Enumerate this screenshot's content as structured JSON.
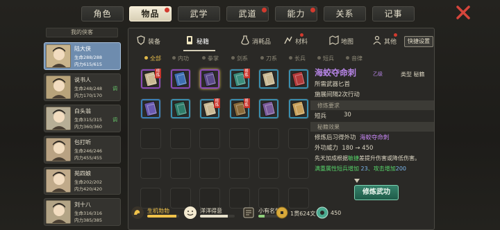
{
  "top_tabs": [
    {
      "label": "角色",
      "active": false,
      "badge": false
    },
    {
      "label": "物品",
      "active": true,
      "badge": true
    },
    {
      "label": "武学",
      "active": false,
      "badge": false
    },
    {
      "label": "武道",
      "active": false,
      "badge": true
    },
    {
      "label": "能力",
      "active": false,
      "badge": true
    },
    {
      "label": "关系",
      "active": false,
      "badge": false
    },
    {
      "label": "记事",
      "active": false,
      "badge": false
    }
  ],
  "sidebar": {
    "title": "我的侠客",
    "characters": [
      {
        "name": "陆大侠",
        "hp": "生命288/288",
        "mp": "内力615/615",
        "selected": true,
        "tag": ""
      },
      {
        "name": "说书人",
        "hp": "生命248/248",
        "mp": "内力170/170",
        "selected": false,
        "tag": "调"
      },
      {
        "name": "白头翁",
        "hp": "生命315/315",
        "mp": "内力360/360",
        "selected": false,
        "tag": "调"
      },
      {
        "name": "包打听",
        "hp": "生命246/246",
        "mp": "内力455/455",
        "selected": false,
        "tag": ""
      },
      {
        "name": "苑四娘",
        "hp": "生命202/202",
        "mp": "内力420/420",
        "selected": false,
        "tag": ""
      },
      {
        "name": "刘十八",
        "hp": "生命316/316",
        "mp": "内力385/385",
        "selected": false,
        "tag": ""
      }
    ]
  },
  "subtabs": [
    {
      "label": "装备",
      "active": false,
      "badge": false,
      "icon": "armor-icon"
    },
    {
      "label": "秘籍",
      "active": true,
      "badge": false,
      "icon": "book-icon"
    },
    {
      "label": "消耗品",
      "active": false,
      "badge": false,
      "icon": "potion-icon"
    },
    {
      "label": "材料",
      "active": false,
      "badge": true,
      "icon": "material-icon"
    },
    {
      "label": "地图",
      "active": false,
      "badge": false,
      "icon": "map-icon"
    },
    {
      "label": "其他",
      "active": false,
      "badge": true,
      "icon": "other-icon"
    }
  ],
  "quick_settings_label": "快捷设置",
  "filters": [
    {
      "label": "全部",
      "active": true
    },
    {
      "label": "内功",
      "active": false
    },
    {
      "label": "拳掌",
      "active": false
    },
    {
      "label": "剑系",
      "active": false
    },
    {
      "label": "刀系",
      "active": false
    },
    {
      "label": "长兵",
      "active": false
    },
    {
      "label": "短兵",
      "active": false
    },
    {
      "label": "音律",
      "active": false
    }
  ],
  "books": [
    {
      "frame": "#8b49b5",
      "color": "#c9b893",
      "ribbon": "修炼",
      "selected": false
    },
    {
      "frame": "#8b49b5",
      "color": "#3f6fb3",
      "ribbon": "",
      "selected": false
    },
    {
      "frame": "#8b49b5",
      "color": "#5c4a8a",
      "ribbon": "",
      "selected": true
    },
    {
      "frame": "#3a8fb0",
      "color": "#3b8c7b",
      "ribbon": "修炼",
      "selected": false
    },
    {
      "frame": "#3a8fb0",
      "color": "#c9b893",
      "ribbon": "",
      "selected": false
    },
    {
      "frame": "#3a8fb0",
      "color": "#b23a3a",
      "ribbon": "",
      "selected": false
    },
    {
      "frame": "#3a7fb8",
      "color": "#6a5ab0",
      "ribbon": "",
      "selected": false
    },
    {
      "frame": "#3a8fb0",
      "color": "#2f7d6a",
      "ribbon": "",
      "selected": false
    },
    {
      "frame": "#3a8fb0",
      "color": "#c9b893",
      "ribbon": "修炼",
      "selected": false
    },
    {
      "frame": "#3a8fb0",
      "color": "#8a6a3a",
      "ribbon": "修炼",
      "selected": false
    },
    {
      "frame": "#3a8fb0",
      "color": "#7a5a9a",
      "ribbon": "",
      "selected": false
    },
    {
      "frame": "#3a8fb0",
      "color": "#c9a05a",
      "ribbon": "",
      "selected": false
    }
  ],
  "empty_slots": 18,
  "detail": {
    "title": "海蛟夺命刺",
    "grade": "乙级",
    "type": "类型  秘籍",
    "weapon_req": "所需武器匕首",
    "cooldown": "施展间隔2次行动",
    "req_header": "修炼要求",
    "req_name": "短兵",
    "req_value": "30",
    "effect_header": "秘籍效果",
    "effect_prefix": "修炼后习得外功",
    "effect_skill": "海蛟夺命刺",
    "power_label": "外功威力",
    "power_value": "180 → 450",
    "innate_prefix": "先天加成根据",
    "innate_attr": "敏捷",
    "innate_suffix": "差提升伤害或降低伤害。",
    "mastery_prefix": "满重属性短兵增加",
    "mastery_val1": "23",
    "mastery_mid": "、攻击增加",
    "mastery_val2": "200",
    "train_button": "修炼武功"
  },
  "bottom": {
    "vitality_label": "生机勃勃",
    "vitality_fill": 0.92,
    "mood_label": "洋洋得意",
    "mood_fill": 0.8,
    "fame_label": "小有名气",
    "fame_fill": 0.25,
    "money": "1贯624文",
    "other_currency": "450"
  }
}
